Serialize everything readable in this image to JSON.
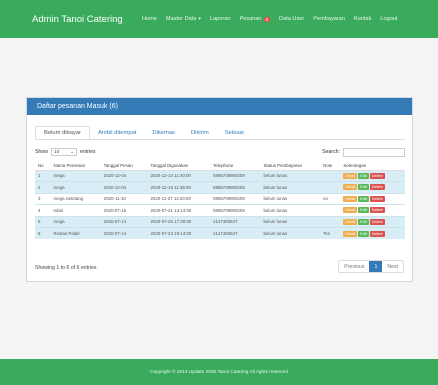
{
  "brand": "Admin Tanoi Catering",
  "nav": {
    "home": "Home",
    "master_data": "Master Data",
    "laporan": "Laporan",
    "pesanan": "Pesanan",
    "pesanan_badge": "6",
    "data_user": "Data User",
    "pembayaran": "Pembayaran",
    "kontak": "Kontak",
    "logout": "Logout"
  },
  "panel": {
    "title": "Daftar pesanan Masuk (6)"
  },
  "tabs": [
    "Belum dibayar",
    "Ambil ditempat",
    "Dikemas",
    "Dikirim",
    "Selesai"
  ],
  "controls": {
    "show_label": "Show",
    "page_size": "10",
    "entries_label": "entries",
    "search_label": "Search:"
  },
  "table": {
    "headers": [
      "No",
      "Nama Pemesan",
      "Tanggal Pesan",
      "Tanggal Digunakan",
      "Telephone",
      "Status Pembayaran",
      "Note",
      "Keterangan"
    ],
    "rows": [
      {
        "no": "1",
        "nama": "mega",
        "tgl_pesan": "2020-12-04",
        "tgl_guna": "2020-12-14 11:40:00",
        "telp": "0895709900209",
        "status": "belum lunas",
        "note": ""
      },
      {
        "no": "2",
        "nama": "mega",
        "tgl_pesan": "2020-12-04",
        "tgl_guna": "2020-12-19 11:38:00",
        "telp": "0895709900209",
        "status": "belum lunas",
        "note": ""
      },
      {
        "no": "3",
        "nama": "mega ramdang",
        "tgl_pesan": "2020-11-10",
        "tgl_guna": "2020-11-27 14:20:00",
        "telp": "0895709900209",
        "status": "belum lunas",
        "note": "no"
      },
      {
        "no": "4",
        "nama": "tufail",
        "tgl_pesan": "2020-07-15",
        "tgl_guna": "2020-07-31 13:14:00",
        "telp": "0895709900209",
        "status": "belum lunas",
        "note": ""
      },
      {
        "no": "5",
        "nama": "mega",
        "tgl_pesan": "2020-07-14",
        "tgl_guna": "2020-07-25 17:30:00",
        "telp": "2147483647",
        "status": "belum lunas",
        "note": ""
      },
      {
        "no": "6",
        "nama": "Roslan Palah",
        "tgl_pesan": "2020-07-14",
        "tgl_guna": "2020-07-24 19:14:00",
        "telp": "2147483647",
        "status": "belum lunas",
        "note": "Tes"
      }
    ],
    "actions": {
      "detail": "Detail",
      "edit": "Edit",
      "delete": "Delete"
    }
  },
  "pagination": {
    "info": "Showing 1 to 6 of 6 entries",
    "previous": "Previous",
    "current": "1",
    "next": "Next"
  },
  "footer": "Copyright © 2013 Update 2020 Tanoi Catering All rights reserved"
}
